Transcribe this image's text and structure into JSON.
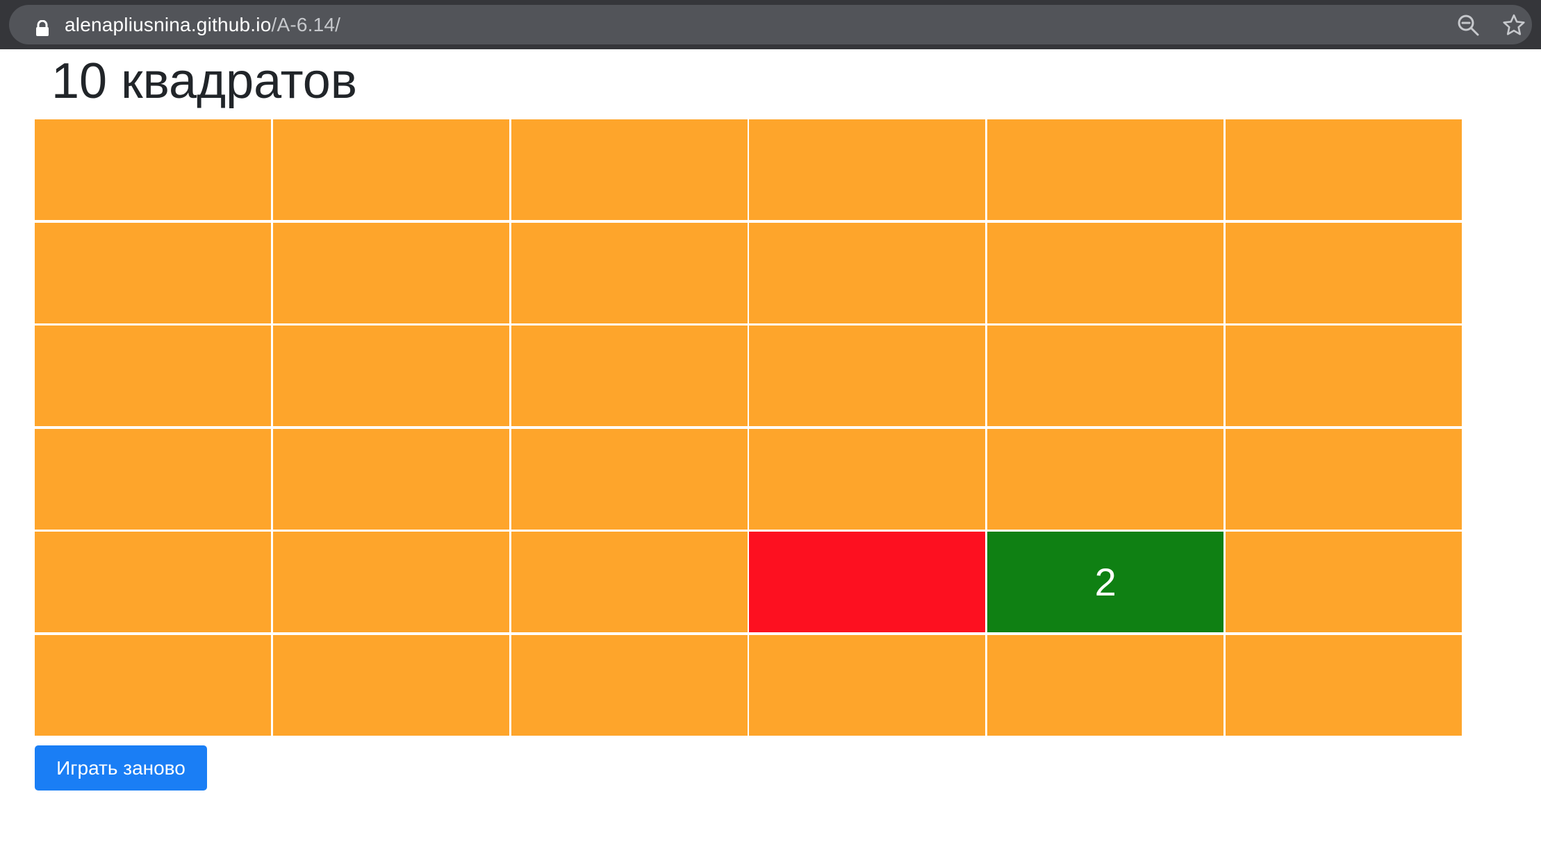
{
  "browser": {
    "url_host": "alenapliusnina.github.io",
    "url_path": "/A-6.14/",
    "icons": [
      "lock-icon",
      "zoom-out-icon",
      "star-icon"
    ]
  },
  "page": {
    "title": "10 квадратов",
    "restart_label": "Играть заново"
  },
  "colors": {
    "cell": "#fea52b",
    "red": "#fd1020",
    "green": "#0f8013",
    "button": "#1a7ef5"
  },
  "board": {
    "rows": 6,
    "cols": 6,
    "cells": [
      [
        {
          "state": "orange",
          "label": ""
        },
        {
          "state": "orange",
          "label": ""
        },
        {
          "state": "orange",
          "label": ""
        },
        {
          "state": "orange",
          "label": ""
        },
        {
          "state": "orange",
          "label": ""
        },
        {
          "state": "orange",
          "label": ""
        }
      ],
      [
        {
          "state": "orange",
          "label": ""
        },
        {
          "state": "orange",
          "label": ""
        },
        {
          "state": "orange",
          "label": ""
        },
        {
          "state": "orange",
          "label": ""
        },
        {
          "state": "orange",
          "label": ""
        },
        {
          "state": "orange",
          "label": ""
        }
      ],
      [
        {
          "state": "orange",
          "label": ""
        },
        {
          "state": "orange",
          "label": ""
        },
        {
          "state": "orange",
          "label": ""
        },
        {
          "state": "orange",
          "label": ""
        },
        {
          "state": "orange",
          "label": ""
        },
        {
          "state": "orange",
          "label": ""
        }
      ],
      [
        {
          "state": "orange",
          "label": ""
        },
        {
          "state": "orange",
          "label": ""
        },
        {
          "state": "orange",
          "label": ""
        },
        {
          "state": "orange",
          "label": ""
        },
        {
          "state": "orange",
          "label": ""
        },
        {
          "state": "orange",
          "label": ""
        }
      ],
      [
        {
          "state": "orange",
          "label": ""
        },
        {
          "state": "orange",
          "label": ""
        },
        {
          "state": "orange",
          "label": ""
        },
        {
          "state": "red",
          "label": ""
        },
        {
          "state": "green",
          "label": "2"
        },
        {
          "state": "orange",
          "label": ""
        }
      ],
      [
        {
          "state": "orange",
          "label": ""
        },
        {
          "state": "orange",
          "label": ""
        },
        {
          "state": "orange",
          "label": ""
        },
        {
          "state": "orange",
          "label": ""
        },
        {
          "state": "orange",
          "label": ""
        },
        {
          "state": "orange",
          "label": ""
        }
      ]
    ]
  }
}
